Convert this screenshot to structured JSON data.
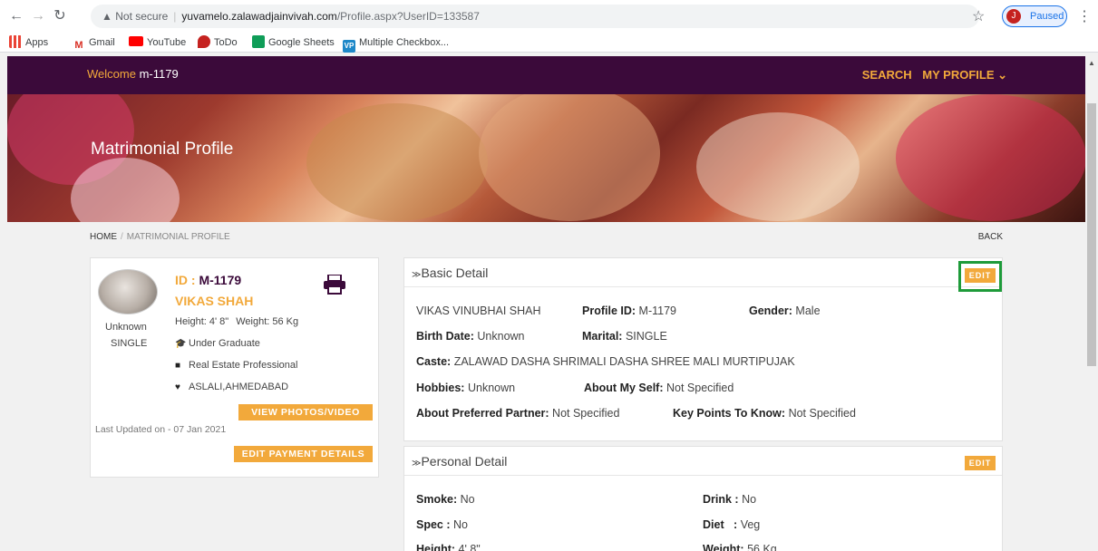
{
  "browser": {
    "security_label": "Not secure",
    "url_host": "yuvamelo.zalawadjainvivah.com",
    "url_path": "/Profile.aspx?UserID=133587",
    "profile_initial": "J",
    "profile_status": "Paused",
    "bookmarks": [
      {
        "label": "Apps",
        "icon": "apps-grid-icon",
        "color": "#ea4335"
      },
      {
        "label": "Gmail",
        "icon": "gmail-icon",
        "color": "#d93025"
      },
      {
        "label": "YouTube",
        "icon": "youtube-icon",
        "color": "#ff0000"
      },
      {
        "label": "ToDo",
        "icon": "todo-icon",
        "color": "#c5221f"
      },
      {
        "label": "Google Sheets",
        "icon": "sheets-icon",
        "color": "#0f9d58"
      },
      {
        "label": "Multiple Checkbox...",
        "icon": "vp-icon",
        "color": "#1e88c8"
      }
    ]
  },
  "site": {
    "welcome_prefix": "Welcome",
    "welcome_user": "m-1179",
    "menu": {
      "search": "SEARCH",
      "my_profile": "MY PROFILE ⌄"
    },
    "hero_title": "Matrimonial Profile",
    "breadcrumb": {
      "home": "HOME",
      "separator": "/",
      "current": "MATRIMONIAL PROFILE"
    },
    "back": "BACK",
    "colors": {
      "nav_bg": "#3b0a3a",
      "accent": "#f2a93b",
      "highlight": "#1e9b3a"
    }
  },
  "profile_card": {
    "id_label": "ID :",
    "id_value": "M-1179",
    "name": "VIKAS SHAH",
    "status_line1": "Unknown",
    "status_line2": "SINGLE",
    "height": "Height: 4' 8\"",
    "weight": "Weight: 56 Kg",
    "education": "Under Graduate",
    "profession": "Real Estate Professional",
    "location": "ASLALI,AHMEDABAD",
    "view_photos_button": "VIEW PHOTOS/VIDEO",
    "last_updated": "Last Updated on - 07 Jan 2021",
    "edit_payment_button": "EDIT PAYMENT DETAILS"
  },
  "basic_detail": {
    "title": "Basic Detail",
    "edit_label": "EDIT",
    "full_name": "VIKAS VINUBHAI SHAH",
    "profile_id_label": "Profile ID:",
    "profile_id_value": "M-1179",
    "gender_label": "Gender:",
    "gender_value": "Male",
    "birth_date_label": "Birth Date:",
    "birth_date_value": "Unknown",
    "marital_label": "Marital:",
    "marital_value": "SINGLE",
    "caste_label": "Caste:",
    "caste_value": "ZALAWAD DASHA SHRIMALI DASHA SHREE MALI MURTIPUJAK",
    "hobbies_label": "Hobbies:",
    "hobbies_value": "Unknown",
    "about_self_label": "About My Self:",
    "about_self_value": "Not Specified",
    "about_partner_label": "About Preferred Partner:",
    "about_partner_value": "Not Specified",
    "key_points_label": "Key Points To Know:",
    "key_points_value": "Not Specified"
  },
  "personal_detail": {
    "title": "Personal Detail",
    "edit_label": "EDIT",
    "smoke_label": "Smoke:",
    "smoke_value": "No",
    "drink_label": "Drink :",
    "drink_value": "No",
    "spec_label": "Spec :",
    "spec_value": "No",
    "diet_label": "Diet   :",
    "diet_value": "Veg",
    "height_label": "Height:",
    "height_value": "4' 8\"",
    "weight_label": "Weight:",
    "weight_value": "56 Kg"
  }
}
